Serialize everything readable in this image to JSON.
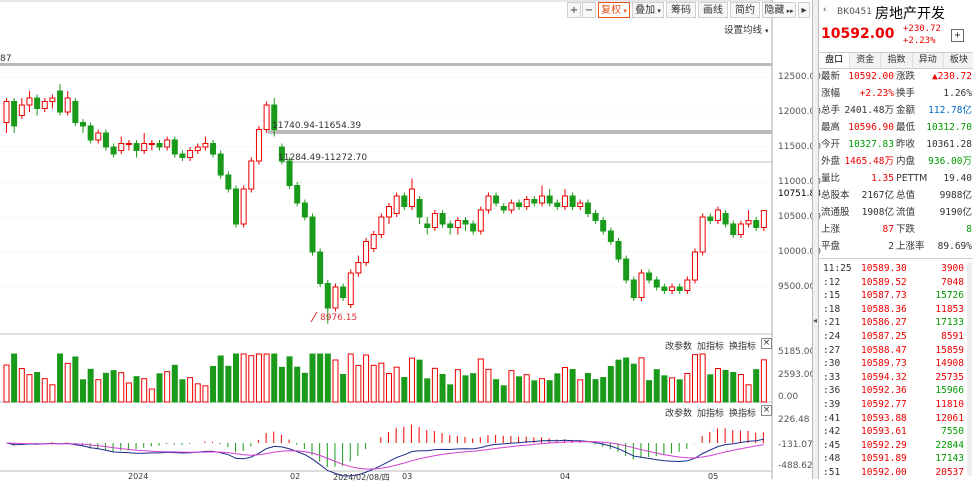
{
  "toolbar": {
    "plus": "+",
    "minus": "−",
    "adjust": "复权",
    "overlay": "叠加",
    "chip": "筹码",
    "draw": "画线",
    "brief": "简约",
    "hide": "隐藏",
    "ma_settings": "设置均线",
    "collapse": "▸"
  },
  "main_chart": {
    "top_left_value": "87",
    "price_axis": [
      "12500.00",
      "12000.00",
      "11500.00",
      "11000.00",
      "10751.88",
      "10500.00",
      "10000.00",
      "9500.00"
    ],
    "gap_label_1": "11740.94-11654.39",
    "gap_label_2": "11284.49-11272.70",
    "low_label": "8976.15",
    "candles": [
      {
        "o": 11850,
        "c": 12150,
        "h": 12200,
        "l": 11700
      },
      {
        "o": 12150,
        "c": 11800,
        "h": 12200,
        "l": 11700
      },
      {
        "o": 11950,
        "c": 12100,
        "h": 12200,
        "l": 11900
      },
      {
        "o": 12100,
        "c": 12200,
        "h": 12300,
        "l": 12000
      },
      {
        "o": 12200,
        "c": 12050,
        "h": 12250,
        "l": 11950
      },
      {
        "o": 12050,
        "c": 12150,
        "h": 12200,
        "l": 12000
      },
      {
        "o": 12150,
        "c": 12200,
        "h": 12250,
        "l": 12050
      },
      {
        "o": 12300,
        "c": 12000,
        "h": 12400,
        "l": 11950
      },
      {
        "o": 12000,
        "c": 12200,
        "h": 12300,
        "l": 11950
      },
      {
        "o": 12150,
        "c": 11850,
        "h": 12200,
        "l": 11800
      },
      {
        "o": 11850,
        "c": 11800,
        "h": 11900,
        "l": 11700
      },
      {
        "o": 11800,
        "c": 11600,
        "h": 11850,
        "l": 11550
      },
      {
        "o": 11600,
        "c": 11700,
        "h": 11750,
        "l": 11550
      },
      {
        "o": 11700,
        "c": 11500,
        "h": 11750,
        "l": 11450
      },
      {
        "o": 11500,
        "c": 11400,
        "h": 11550,
        "l": 11350
      },
      {
        "o": 11450,
        "c": 11550,
        "h": 11650,
        "l": 11400
      },
      {
        "o": 11550,
        "c": 11550,
        "h": 11600,
        "l": 11450
      },
      {
        "o": 11550,
        "c": 11450,
        "h": 11600,
        "l": 11350
      },
      {
        "o": 11450,
        "c": 11550,
        "h": 11700,
        "l": 11400
      },
      {
        "o": 11550,
        "c": 11550,
        "h": 11600,
        "l": 11450
      },
      {
        "o": 11550,
        "c": 11500,
        "h": 11600,
        "l": 11450
      },
      {
        "o": 11500,
        "c": 11600,
        "h": 11650,
        "l": 11450
      },
      {
        "o": 11600,
        "c": 11400,
        "h": 11650,
        "l": 11350
      },
      {
        "o": 11400,
        "c": 11350,
        "h": 11450,
        "l": 11300
      },
      {
        "o": 11350,
        "c": 11450,
        "h": 11500,
        "l": 11300
      },
      {
        "o": 11450,
        "c": 11500,
        "h": 11550,
        "l": 11400
      },
      {
        "o": 11500,
        "c": 11550,
        "h": 11650,
        "l": 11450
      },
      {
        "o": 11550,
        "c": 11400,
        "h": 11600,
        "l": 11350
      },
      {
        "o": 11400,
        "c": 11100,
        "h": 11450,
        "l": 11050
      },
      {
        "o": 11100,
        "c": 10900,
        "h": 11150,
        "l": 10850
      },
      {
        "o": 10900,
        "c": 10400,
        "h": 10950,
        "l": 10350
      },
      {
        "o": 10400,
        "c": 10900,
        "h": 10950,
        "l": 10350
      },
      {
        "o": 10900,
        "c": 11300,
        "h": 11350,
        "l": 10850
      },
      {
        "o": 11300,
        "c": 11750,
        "h": 11800,
        "l": 11250
      },
      {
        "o": 11750,
        "c": 12100,
        "h": 12150,
        "l": 11700
      },
      {
        "o": 12100,
        "c": 11750,
        "h": 12200,
        "l": 11650
      },
      {
        "o": 11500,
        "c": 11300,
        "h": 11550,
        "l": 11250
      },
      {
        "o": 11300,
        "c": 10950,
        "h": 11350,
        "l": 10900
      },
      {
        "o": 10950,
        "c": 10700,
        "h": 11000,
        "l": 10650
      },
      {
        "o": 10700,
        "c": 10500,
        "h": 10750,
        "l": 10450
      },
      {
        "o": 10500,
        "c": 10000,
        "h": 10550,
        "l": 9950
      },
      {
        "o": 10000,
        "c": 9550,
        "h": 10050,
        "l": 9500
      },
      {
        "o": 9550,
        "c": 9200,
        "h": 9600,
        "l": 8976
      },
      {
        "o": 9200,
        "c": 9500,
        "h": 9550,
        "l": 9150
      },
      {
        "o": 9500,
        "c": 9350,
        "h": 9550,
        "l": 9300
      },
      {
        "o": 9250,
        "c": 9700,
        "h": 9750,
        "l": 9200
      },
      {
        "o": 9700,
        "c": 9850,
        "h": 9950,
        "l": 9650
      },
      {
        "o": 9850,
        "c": 10150,
        "h": 10200,
        "l": 9800
      },
      {
        "o": 10050,
        "c": 10250,
        "h": 10300,
        "l": 10000
      },
      {
        "o": 10250,
        "c": 10500,
        "h": 10550,
        "l": 10200
      },
      {
        "o": 10500,
        "c": 10650,
        "h": 10700,
        "l": 10400
      },
      {
        "o": 10550,
        "c": 10800,
        "h": 10850,
        "l": 10500
      },
      {
        "o": 10800,
        "c": 10650,
        "h": 10850,
        "l": 10600
      },
      {
        "o": 10650,
        "c": 10900,
        "h": 11050,
        "l": 10600
      },
      {
        "o": 10750,
        "c": 10500,
        "h": 10800,
        "l": 10400
      },
      {
        "o": 10400,
        "c": 10350,
        "h": 10500,
        "l": 10250
      },
      {
        "o": 10350,
        "c": 10550,
        "h": 10600,
        "l": 10300
      },
      {
        "o": 10550,
        "c": 10400,
        "h": 10600,
        "l": 10350
      },
      {
        "o": 10400,
        "c": 10350,
        "h": 10450,
        "l": 10250
      },
      {
        "o": 10350,
        "c": 10450,
        "h": 10500,
        "l": 10250
      },
      {
        "o": 10450,
        "c": 10400,
        "h": 10500,
        "l": 10300
      },
      {
        "o": 10400,
        "c": 10300,
        "h": 10450,
        "l": 10250
      },
      {
        "o": 10300,
        "c": 10600,
        "h": 10650,
        "l": 10250
      },
      {
        "o": 10600,
        "c": 10800,
        "h": 10850,
        "l": 10550
      },
      {
        "o": 10800,
        "c": 10700,
        "h": 10850,
        "l": 10650
      },
      {
        "o": 10650,
        "c": 10600,
        "h": 10700,
        "l": 10550
      },
      {
        "o": 10600,
        "c": 10700,
        "h": 10750,
        "l": 10550
      },
      {
        "o": 10700,
        "c": 10650,
        "h": 10750,
        "l": 10600
      },
      {
        "o": 10650,
        "c": 10750,
        "h": 10800,
        "l": 10600
      },
      {
        "o": 10750,
        "c": 10700,
        "h": 10800,
        "l": 10650
      },
      {
        "o": 10700,
        "c": 10800,
        "h": 10950,
        "l": 10650
      },
      {
        "o": 10800,
        "c": 10700,
        "h": 10900,
        "l": 10650
      },
      {
        "o": 10700,
        "c": 10650,
        "h": 10750,
        "l": 10600
      },
      {
        "o": 10650,
        "c": 10800,
        "h": 10900,
        "l": 10600
      },
      {
        "o": 10800,
        "c": 10650,
        "h": 10850,
        "l": 10600
      },
      {
        "o": 10650,
        "c": 10700,
        "h": 10750,
        "l": 10600
      },
      {
        "o": 10700,
        "c": 10550,
        "h": 10750,
        "l": 10500
      },
      {
        "o": 10550,
        "c": 10450,
        "h": 10600,
        "l": 10400
      },
      {
        "o": 10450,
        "c": 10300,
        "h": 10500,
        "l": 10250
      },
      {
        "o": 10300,
        "c": 10150,
        "h": 10350,
        "l": 10100
      },
      {
        "o": 10150,
        "c": 9900,
        "h": 10200,
        "l": 9850
      },
      {
        "o": 9900,
        "c": 9600,
        "h": 9950,
        "l": 9550
      },
      {
        "o": 9600,
        "c": 9350,
        "h": 9650,
        "l": 9300
      },
      {
        "o": 9350,
        "c": 9700,
        "h": 9750,
        "l": 9300
      },
      {
        "o": 9700,
        "c": 9600,
        "h": 9750,
        "l": 9550
      },
      {
        "o": 9600,
        "c": 9500,
        "h": 9650,
        "l": 9450
      },
      {
        "o": 9500,
        "c": 9450,
        "h": 9550,
        "l": 9400
      },
      {
        "o": 9450,
        "c": 9500,
        "h": 9550,
        "l": 9400
      },
      {
        "o": 9500,
        "c": 9450,
        "h": 9550,
        "l": 9400
      },
      {
        "o": 9450,
        "c": 9600,
        "h": 9650,
        "l": 9400
      },
      {
        "o": 9600,
        "c": 10000,
        "h": 10050,
        "l": 9550
      },
      {
        "o": 10000,
        "c": 10500,
        "h": 10550,
        "l": 9950
      },
      {
        "o": 10500,
        "c": 10450,
        "h": 10550,
        "l": 10400
      },
      {
        "o": 10450,
        "c": 10600,
        "h": 10650,
        "l": 10400
      },
      {
        "o": 10550,
        "c": 10400,
        "h": 10600,
        "l": 10350
      },
      {
        "o": 10400,
        "c": 10250,
        "h": 10450,
        "l": 10200
      },
      {
        "o": 10250,
        "c": 10400,
        "h": 10450,
        "l": 10200
      },
      {
        "o": 10400,
        "c": 10450,
        "h": 10600,
        "l": 10350
      },
      {
        "o": 10450,
        "c": 10350,
        "h": 10500,
        "l": 10300
      },
      {
        "o": 10350,
        "c": 10592,
        "h": 10600,
        "l": 10300
      }
    ]
  },
  "volume_panel": {
    "buttons": [
      "改参数",
      "加指标",
      "换指标"
    ],
    "close": "×",
    "axis": [
      "5185.00",
      "2593.00",
      "0.00"
    ]
  },
  "macd_panel": {
    "buttons": [
      "改参数",
      "加指标",
      "换指标"
    ],
    "close": "×",
    "axis": [
      "226.48",
      "-131.07",
      "-488.62"
    ]
  },
  "date_axis": [
    "2024",
    "02",
    "2024/02/08/四",
    "03",
    "04",
    "05"
  ],
  "quote": {
    "code": "BK0451",
    "name": "房地产开发",
    "price": "10592.00",
    "change": "+230.72",
    "change_pct": "+2.23%",
    "add_btn": "+"
  },
  "tabs": [
    "盘口",
    "资金",
    "指数",
    "异动",
    "板块"
  ],
  "rows": [
    [
      {
        "l": "最新",
        "v": "10592.00",
        "c": "red"
      },
      {
        "l": "涨跌",
        "v": "▲230.72",
        "c": "red"
      }
    ],
    [
      {
        "l": "涨幅",
        "v": "+2.23%",
        "c": "red"
      },
      {
        "l": "换手",
        "v": "1.26%",
        "c": ""
      }
    ],
    [
      {
        "l": "总手",
        "v": "2401.48万",
        "c": ""
      },
      {
        "l": "金额",
        "v": "112.78亿",
        "c": "blue"
      }
    ],
    [
      {
        "l": "最高",
        "v": "10596.90",
        "c": "red"
      },
      {
        "l": "最低",
        "v": "10312.70",
        "c": "green"
      }
    ],
    [
      {
        "l": "今开",
        "v": "10327.83",
        "c": "green"
      },
      {
        "l": "昨收",
        "v": "10361.28",
        "c": ""
      }
    ],
    [
      {
        "l": "外盘",
        "v": "1465.48万",
        "c": "red"
      },
      {
        "l": "内盘",
        "v": "936.00万",
        "c": "green"
      }
    ],
    [
      {
        "l": "量比",
        "v": "1.35",
        "c": "red"
      },
      {
        "l": "PETTM",
        "v": "19.40",
        "c": ""
      }
    ],
    [
      {
        "l": "总股本",
        "v": "2167亿",
        "c": ""
      },
      {
        "l": "总值",
        "v": "9988亿",
        "c": ""
      }
    ],
    [
      {
        "l": "流通股",
        "v": "1908亿",
        "c": ""
      },
      {
        "l": "流值",
        "v": "9190亿",
        "c": ""
      }
    ],
    [
      {
        "l": "上涨",
        "v": "87",
        "c": "red"
      },
      {
        "l": "下跌",
        "v": "8",
        "c": "green"
      }
    ],
    [
      {
        "l": "平盘",
        "v": "2",
        "c": ""
      },
      {
        "l": "上涨率",
        "v": "89.69%",
        "c": ""
      }
    ]
  ],
  "ticks": [
    {
      "t": "11:25",
      "p": "10589.30",
      "v": "3900",
      "vc": "red"
    },
    {
      "t": ":12",
      "p": "10589.52",
      "v": "7048",
      "vc": "red"
    },
    {
      "t": ":15",
      "p": "10587.73",
      "v": "15726",
      "vc": "green"
    },
    {
      "t": ":18",
      "p": "10588.36",
      "v": "11853",
      "vc": "red"
    },
    {
      "t": ":21",
      "p": "10586.27",
      "v": "17133",
      "vc": "green"
    },
    {
      "t": ":24",
      "p": "10587.25",
      "v": "8591",
      "vc": "red"
    },
    {
      "t": ":27",
      "p": "10588.47",
      "v": "15859",
      "vc": "red"
    },
    {
      "t": ":30",
      "p": "10589.73",
      "v": "14908",
      "vc": "red"
    },
    {
      "t": ":33",
      "p": "10594.32",
      "v": "25735",
      "vc": "red"
    },
    {
      "t": ":36",
      "p": "10592.36",
      "v": "15966",
      "vc": "green"
    },
    {
      "t": ":39",
      "p": "10592.77",
      "v": "11810",
      "vc": "red"
    },
    {
      "t": ":41",
      "p": "10593.88",
      "v": "12061",
      "vc": "red"
    },
    {
      "t": ":42",
      "p": "10593.61",
      "v": "7550",
      "vc": "green"
    },
    {
      "t": ":45",
      "p": "10592.29",
      "v": "22844",
      "vc": "green"
    },
    {
      "t": ":48",
      "p": "10591.89",
      "v": "17143",
      "vc": "green"
    },
    {
      "t": ":51",
      "p": "10592.00",
      "v": "20537",
      "vc": "red"
    }
  ]
}
